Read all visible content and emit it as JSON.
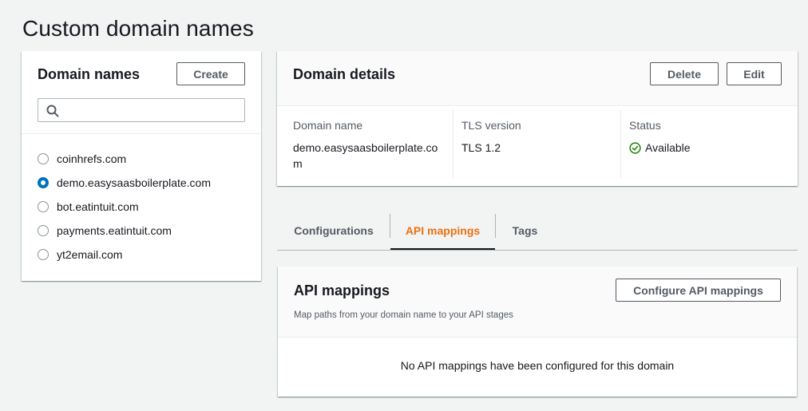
{
  "page": {
    "title": "Custom domain names"
  },
  "domain_names_panel": {
    "title": "Domain names",
    "create_label": "Create",
    "search": {
      "placeholder": "",
      "value": ""
    },
    "domains": [
      {
        "name": "coinhrefs.com",
        "selected": false
      },
      {
        "name": "demo.easysaasboilerplate.com",
        "selected": true
      },
      {
        "name": "bot.eatintuit.com",
        "selected": false
      },
      {
        "name": "payments.eatintuit.com",
        "selected": false
      },
      {
        "name": "yt2email.com",
        "selected": false
      }
    ]
  },
  "domain_details": {
    "title": "Domain details",
    "delete_label": "Delete",
    "edit_label": "Edit",
    "domain_name_label": "Domain name",
    "domain_name_value_line1": "demo.easysaasboilerplate.co",
    "domain_name_value_line2": "m",
    "tls_label": "TLS version",
    "tls_value": "TLS 1.2",
    "status_label": "Status",
    "status_value": "Available",
    "status_icon": "check-circle-icon",
    "status_color": "#1d8102"
  },
  "tabs": [
    {
      "label": "Configurations",
      "active": false
    },
    {
      "label": "API mappings",
      "active": true
    },
    {
      "label": "Tags",
      "active": false
    }
  ],
  "api_mappings": {
    "title": "API mappings",
    "description": "Map paths from your domain name to your API stages",
    "configure_label": "Configure API mappings",
    "empty_message": "No API mappings have been configured for this domain"
  },
  "colors": {
    "accent": "#0073bb",
    "active_tab": "#ec7211",
    "success": "#1d8102"
  }
}
